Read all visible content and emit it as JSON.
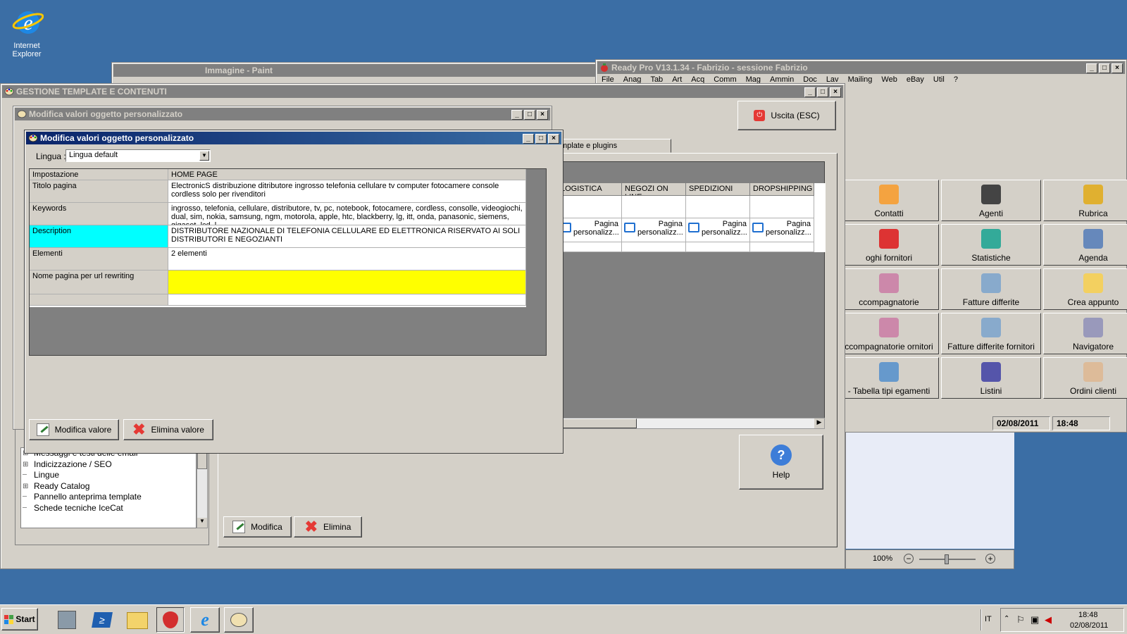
{
  "desktop": {
    "ie_label_1": "Internet",
    "ie_label_2": "Explorer"
  },
  "paint": {
    "title": "Immagine - Paint"
  },
  "readypro": {
    "title": "Ready Pro V13.1.34 - Fabrizio - sessione Fabrizio",
    "menu": [
      "File",
      "Anag",
      "Tab",
      "Art",
      "Acq",
      "Comm",
      "Mag",
      "Ammin",
      "Doc",
      "Lav",
      "Mailing",
      "Web",
      "eBay",
      "Util",
      "?"
    ],
    "tiles": [
      {
        "label": "Contatti",
        "icon": "contacts-icon"
      },
      {
        "label": "Agenti",
        "icon": "agent-icon"
      },
      {
        "label": "Rubrica",
        "icon": "address-book-icon"
      },
      {
        "label": "oghi fornitori",
        "icon": "suppliers-icon"
      },
      {
        "label": "Statistiche",
        "icon": "chart-icon"
      },
      {
        "label": "Agenda",
        "icon": "agenda-icon"
      },
      {
        "label": "ccompagnatorie",
        "icon": "document-icon"
      },
      {
        "label": "Fatture differite",
        "icon": "invoice-icon"
      },
      {
        "label": "Crea appunto",
        "icon": "note-icon"
      },
      {
        "label": "ccompagnatorie ornitori",
        "icon": "document-icon"
      },
      {
        "label": "Fatture differite fornitori",
        "icon": "invoice-icon"
      },
      {
        "label": "Navigatore",
        "icon": "navigator-icon"
      },
      {
        "label": "- Tabella tipi egamenti",
        "icon": "table-icon"
      },
      {
        "label": "Listini",
        "icon": "percent-icon"
      },
      {
        "label": "Ordini clienti",
        "icon": "order-icon"
      }
    ],
    "date": "02/08/2011",
    "time": "18:48"
  },
  "zoom": {
    "value": "100%"
  },
  "gestione": {
    "title": "GESTIONE TEMPLATE E CONTENUTI",
    "exit_label": "Uscita (ESC)",
    "tab_label": "mplate e plugins",
    "columns": [
      "LOGISTICA",
      "NEGOZI ON LINE",
      "SPEDIZIONI",
      "DROPSHIPPING"
    ],
    "cell_value": "Pagina personalizz...",
    "help_label": "Help",
    "modify_label": "Modifica",
    "delete_label": "Elimina",
    "tree": [
      "Messaggi e testi delle email",
      "Indicizzazione / SEO",
      "Lingue",
      "Ready Catalog",
      "Pannello anteprima template",
      "Schede tecniche IceCat"
    ]
  },
  "dialog_back": {
    "title": "Modifica valori oggetto personalizzato"
  },
  "dialog": {
    "title": "Modifica valori oggetto personalizzato",
    "lang_label": "Lingua :",
    "lang_value": "Lingua default",
    "col_setting": "Impostazione",
    "col_value": "HOME PAGE",
    "rows": [
      {
        "key": "Titolo pagina",
        "value": "ElectronicS distribuzione ditributore ingrosso telefonia cellulare tv computer fotocamere console cordless solo per rivenditori"
      },
      {
        "key": "Keywords",
        "value": "ingrosso, telefonia, cellulare, distributore, tv, pc, notebook, fotocamere, cordless, consolle, videogiochi, dual, sim, nokia, samsung, ngm, motorola, apple, htc, blackberry, lg, itt, onda, panasonic, siemens, gigaset, lcd, l..."
      },
      {
        "key": "Description",
        "value": "DISTRIBUTORE NAZIONALE DI TELEFONIA CELLULARE ED ELETTRONICA RISERVATO AI SOLI DISTRIBUTORI E NEGOZIANTI"
      },
      {
        "key": "Elementi",
        "value": "2 elementi"
      },
      {
        "key": "Nome pagina per url rewriting",
        "value": ""
      }
    ],
    "modify_btn": "Modifica valore",
    "delete_btn": "Elimina valore"
  },
  "taskbar": {
    "start": "Start",
    "lang": "IT",
    "time": "18:48",
    "date": "02/08/2011"
  }
}
